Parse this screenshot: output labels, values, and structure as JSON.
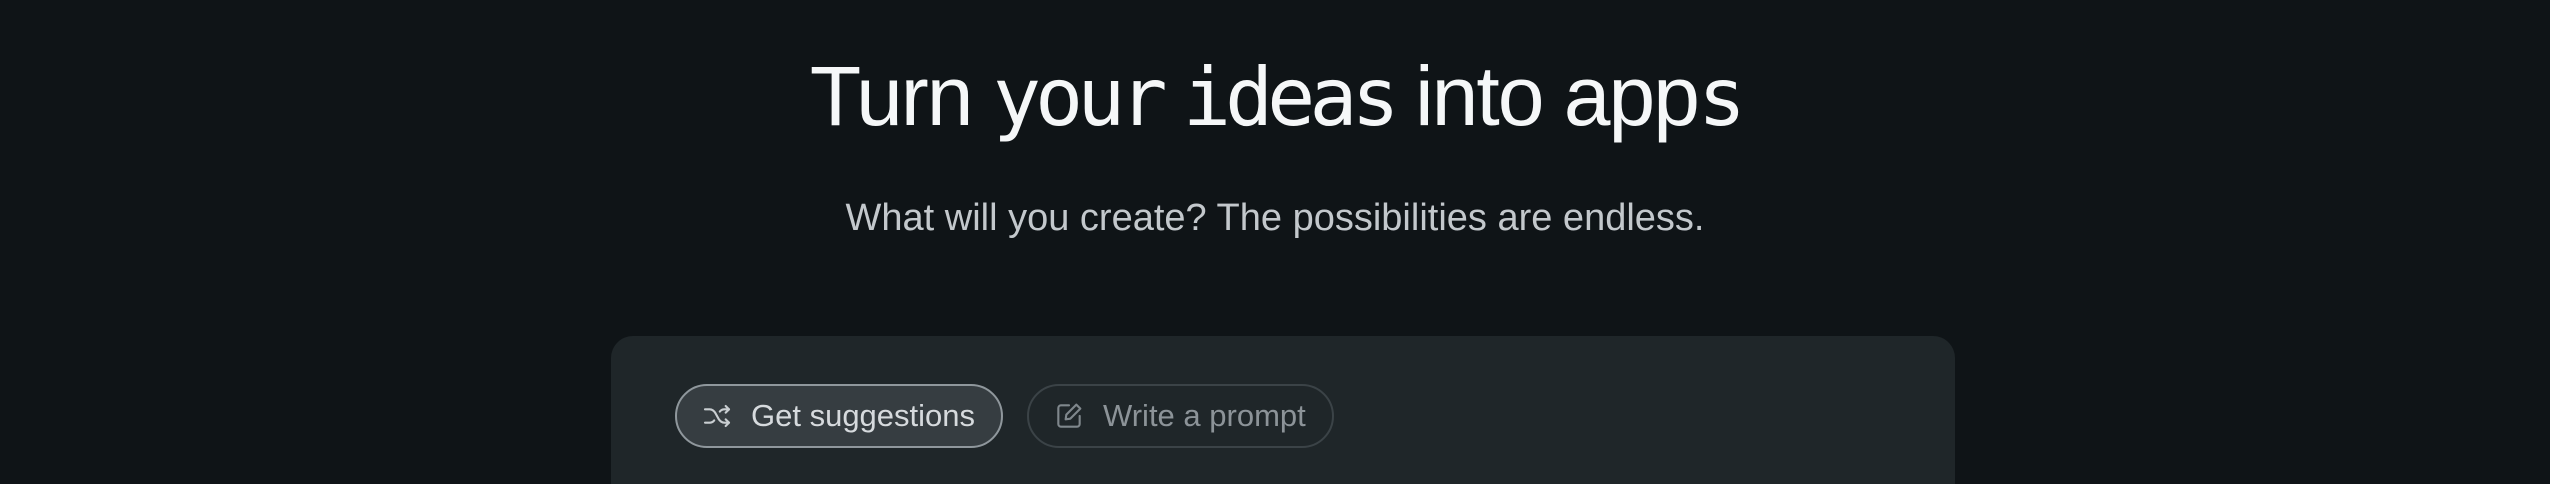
{
  "hero": {
    "title_part1": "Turn ",
    "title_pixel1": "your",
    "title_part2": " ",
    "title_pixel2": "ideas",
    "title_part3": " into app",
    "title_pixel3": "s",
    "subtitle": "What will you create? The possibilities are endless."
  },
  "prompt_card": {
    "tabs": [
      {
        "label": "Get suggestions",
        "icon": "shuffle-icon",
        "active": true
      },
      {
        "label": "Write a prompt",
        "icon": "edit-icon",
        "active": false
      }
    ]
  },
  "colors": {
    "background": "#0f1417",
    "card": "#1f2629",
    "title": "#f5f7f8",
    "subtitle": "#c3c8cc"
  }
}
